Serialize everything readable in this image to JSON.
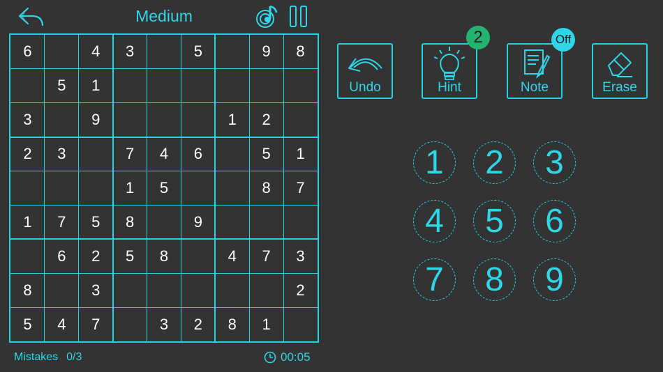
{
  "header": {
    "title": "Medium"
  },
  "board": {
    "rows": [
      [
        "6",
        "",
        "4",
        "3",
        "",
        "5",
        "",
        "9",
        "8"
      ],
      [
        "",
        "5",
        "1",
        "",
        "",
        "",
        "",
        "",
        ""
      ],
      [
        "3",
        "",
        "9",
        "",
        "",
        "",
        "1",
        "2",
        ""
      ],
      [
        "2",
        "3",
        "",
        "7",
        "4",
        "6",
        "",
        "5",
        "1"
      ],
      [
        "",
        "",
        "",
        "1",
        "5",
        "",
        "",
        "8",
        "7"
      ],
      [
        "1",
        "7",
        "5",
        "8",
        "",
        "9",
        "",
        "",
        ""
      ],
      [
        "",
        "6",
        "2",
        "5",
        "8",
        "",
        "4",
        "7",
        "3"
      ],
      [
        "8",
        "",
        "3",
        "",
        "",
        "",
        "",
        "",
        "2"
      ],
      [
        "5",
        "4",
        "7",
        "",
        "3",
        "2",
        "8",
        "1",
        ""
      ]
    ]
  },
  "tools": {
    "undo_label": "Undo",
    "hint_label": "Hint",
    "hint_count": "2",
    "note_label": "Note",
    "note_state": "Off",
    "erase_label": "Erase"
  },
  "numpad": [
    "1",
    "2",
    "3",
    "4",
    "5",
    "6",
    "7",
    "8",
    "9"
  ],
  "footer": {
    "mistakes_label": "Mistakes",
    "mistakes_count": "0/3",
    "timer": "00:05"
  },
  "colors": {
    "accent": "#22d3e6",
    "background": "#333333",
    "hint_badge": "#23b371"
  }
}
